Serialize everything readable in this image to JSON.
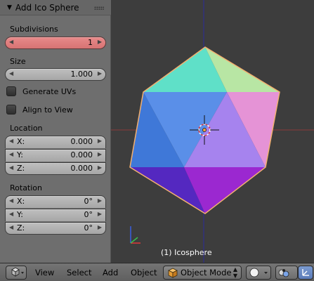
{
  "panel": {
    "title": "Add Ico Sphere",
    "subdivisions": {
      "label": "Subdivisions",
      "value": "1"
    },
    "size": {
      "label": "Size",
      "value": "1.000"
    },
    "generate_uvs": {
      "label": "Generate UVs",
      "checked": false
    },
    "align_to_view": {
      "label": "Align to View",
      "checked": false
    },
    "location": {
      "label": "Location",
      "fields": [
        {
          "axis": "X:",
          "value": "0.000"
        },
        {
          "axis": "Y:",
          "value": "0.000"
        },
        {
          "axis": "Z:",
          "value": "0.000"
        }
      ]
    },
    "rotation": {
      "label": "Rotation",
      "fields": [
        {
          "axis": "X:",
          "value": "0°"
        },
        {
          "axis": "Y:",
          "value": "0°"
        },
        {
          "axis": "Z:",
          "value": "0°"
        }
      ]
    }
  },
  "viewport": {
    "object_label": "(1) Icosphere"
  },
  "header": {
    "menu": [
      "View",
      "Select",
      "Add",
      "Object"
    ],
    "mode": "Object Mode"
  },
  "colors": {
    "face_cyan": "#5fe0c8",
    "face_yellowgreen": "#b8e6a4",
    "face_blue": "#5a8fe8",
    "face_lavender": "#a683ee",
    "face_pink": "#e593d6",
    "face_darkblue": "#3b63c8",
    "face_indigo": "#5428c0",
    "face_purple": "#9b28d0",
    "outline_selected": "#f3b070"
  }
}
